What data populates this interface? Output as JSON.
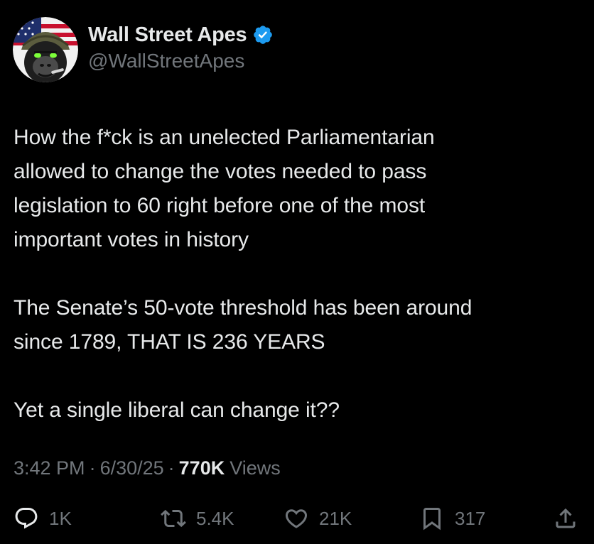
{
  "author": {
    "display_name": "Wall Street Apes",
    "handle": "@WallStreetApes",
    "verified": true,
    "verified_color": "#1d9bf0"
  },
  "tweet": {
    "paragraphs": [
      "How the f*ck is an unelected Parliamentarian\nallowed to change the votes needed to pass\nlegislation to 60 right before one of the most\nimportant votes in history",
      "The Senate’s 50-vote threshold has been around\nsince 1789, THAT IS 236 YEARS",
      "Yet a single liberal can change it??"
    ]
  },
  "meta": {
    "time": "3:42 PM",
    "separator": "·",
    "date": "6/30/25",
    "views_count": "770K",
    "views_label": "Views"
  },
  "actions": {
    "reply_count": "1K",
    "repost_count": "5.4K",
    "like_count": "21K",
    "bookmark_count": "317",
    "icons": {
      "reply": "reply-icon",
      "repost": "repost-icon",
      "like": "heart-icon",
      "bookmark": "bookmark-icon",
      "share": "share-icon"
    }
  },
  "colors": {
    "background": "#000000",
    "text_primary": "#e7e9ea",
    "text_secondary": "#71767b"
  }
}
